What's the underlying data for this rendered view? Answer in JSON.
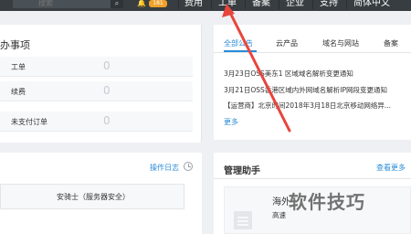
{
  "topbar": {
    "search_placeholder": "搜索",
    "notification_count": "181",
    "nav": [
      "费用",
      "工单",
      "备案",
      "企业",
      "支持",
      "简体中文"
    ]
  },
  "todo": {
    "title": "办事项",
    "rows": [
      {
        "label": "工单",
        "count": "0"
      },
      {
        "label": "续费",
        "count": "0"
      },
      {
        "label": "未支付订单",
        "count": "0"
      }
    ]
  },
  "ops": {
    "log_link": "操作日志",
    "box_text": "安骑士（服务器安全）"
  },
  "notices": {
    "tabs": [
      "全部公告",
      "云产品",
      "域名与网站",
      "备案"
    ],
    "lines": [
      "3月23日OSS美东1 区域域名解析变更通知",
      "3月21日OSS香港区域内外网域名解析IP网段变更通知",
      "【运营商】北京时间2018年3月18日北京移动网络异..."
    ],
    "more": "更多"
  },
  "assistant": {
    "title": "管理助手",
    "more": "查看更多",
    "item_heading": "海外",
    "item_sub": "高速"
  },
  "watermark": "软件技巧",
  "colors": {
    "topbar": "#373d41",
    "accent": "#2a8bd8",
    "badge": "#f0a12a",
    "arrow": "#e8453c"
  }
}
